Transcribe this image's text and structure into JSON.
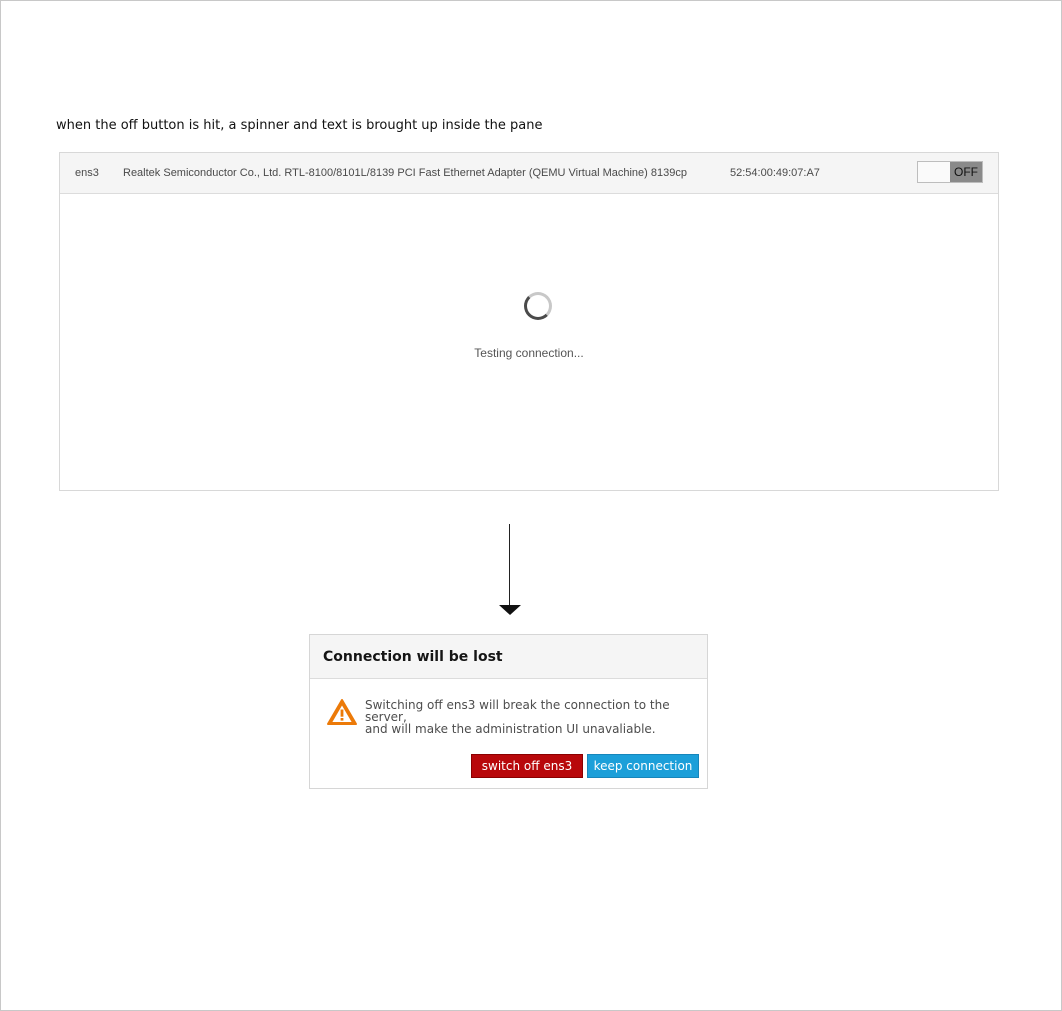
{
  "annotation": "when the off button is hit, a spinner and text is brought up inside the pane",
  "pane": {
    "iface_name": "ens3",
    "iface_desc": "Realtek Semiconductor Co., Ltd. RTL-8100/8101L/8139 PCI Fast Ethernet Adapter (QEMU Virtual Machine) 8139cp",
    "iface_mac": "52:54:00:49:07:A7",
    "toggle_label": "OFF",
    "status_text": "Testing connection..."
  },
  "dialog": {
    "title": "Connection will be lost",
    "message_line1": "Switching off ens3 will break the connection to the server,",
    "message_line2": "and will make the administration UI unavaliable.",
    "danger_button": "switch off ens3",
    "primary_button": "keep connection"
  },
  "icons": {
    "warning": "warning-triangle-icon",
    "spinner": "spinner-icon",
    "arrow": "arrow-down-icon"
  },
  "colors": {
    "danger": "#b8080b",
    "primary": "#1c9fd9",
    "warning": "#ec7a08"
  }
}
